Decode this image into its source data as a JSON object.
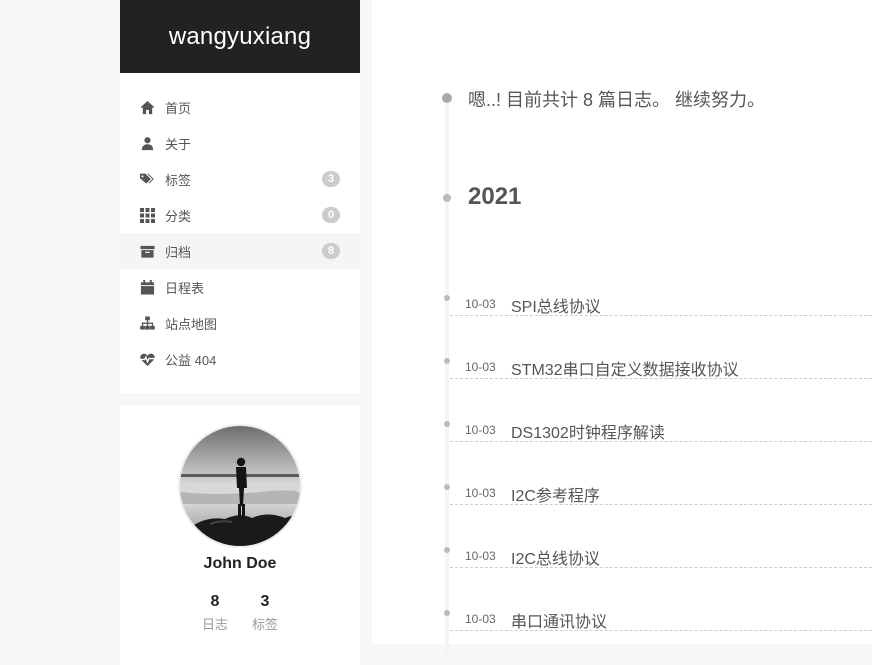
{
  "site": {
    "title": "wangyuxiang"
  },
  "menu": {
    "items": [
      {
        "label": "首页",
        "icon": "home-icon"
      },
      {
        "label": "关于",
        "icon": "user-icon"
      },
      {
        "label": "标签",
        "icon": "tags-icon",
        "badge": "3"
      },
      {
        "label": "分类",
        "icon": "th-icon",
        "badge": "0"
      },
      {
        "label": "归档",
        "icon": "archive-icon",
        "badge": "8"
      },
      {
        "label": "日程表",
        "icon": "calendar-icon"
      },
      {
        "label": "站点地图",
        "icon": "sitemap-icon"
      },
      {
        "label": "公益 404",
        "icon": "heartbeat-icon"
      }
    ]
  },
  "author": {
    "name": "John Doe",
    "posts_count": "8",
    "posts_label": "日志",
    "tags_count": "3",
    "tags_label": "标签"
  },
  "archive": {
    "summary": "嗯..! 目前共计 8 篇日志。 继续努力。",
    "year": "2021",
    "posts": [
      {
        "date": "10-03",
        "title": "SPI总线协议"
      },
      {
        "date": "10-03",
        "title": "STM32串口自定义数据接收协议"
      },
      {
        "date": "10-03",
        "title": "DS1302时钟程序解读"
      },
      {
        "date": "10-03",
        "title": "I2C参考程序"
      },
      {
        "date": "10-03",
        "title": "I2C总线协议"
      },
      {
        "date": "10-03",
        "title": "串口通讯协议"
      }
    ]
  },
  "colors": {
    "brand_bg": "#222222",
    "badge": "#cccccc",
    "timeline_dot": "#bbbbbb"
  }
}
